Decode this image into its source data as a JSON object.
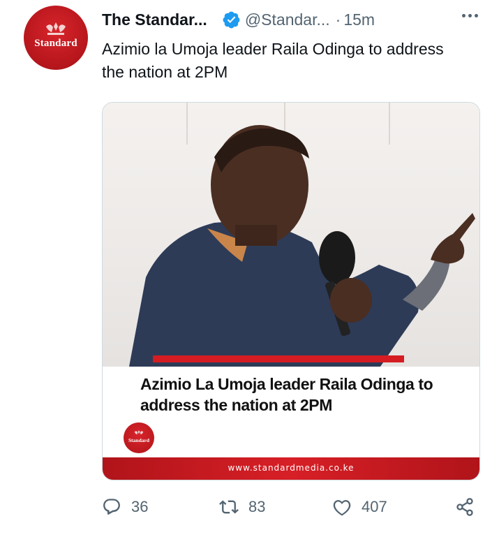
{
  "tweet": {
    "display_name": "The Standar...",
    "handle": "@Standar...",
    "separator": "·",
    "time": "15m",
    "text": "Azimio la Umoja leader Raila Odinga to address the nation at 2PM",
    "avatar_label": "Standard"
  },
  "media": {
    "headline": "Azimio La Umoja leader Raila Odinga to address the nation at 2PM",
    "logo_label": "Standard",
    "url": "www.standardmedia.co.ke"
  },
  "actions": {
    "replies": "36",
    "retweets": "83",
    "likes": "407"
  },
  "colors": {
    "brand_red": "#d41c22",
    "verified_blue": "#1d9bf0",
    "muted": "#536471"
  }
}
